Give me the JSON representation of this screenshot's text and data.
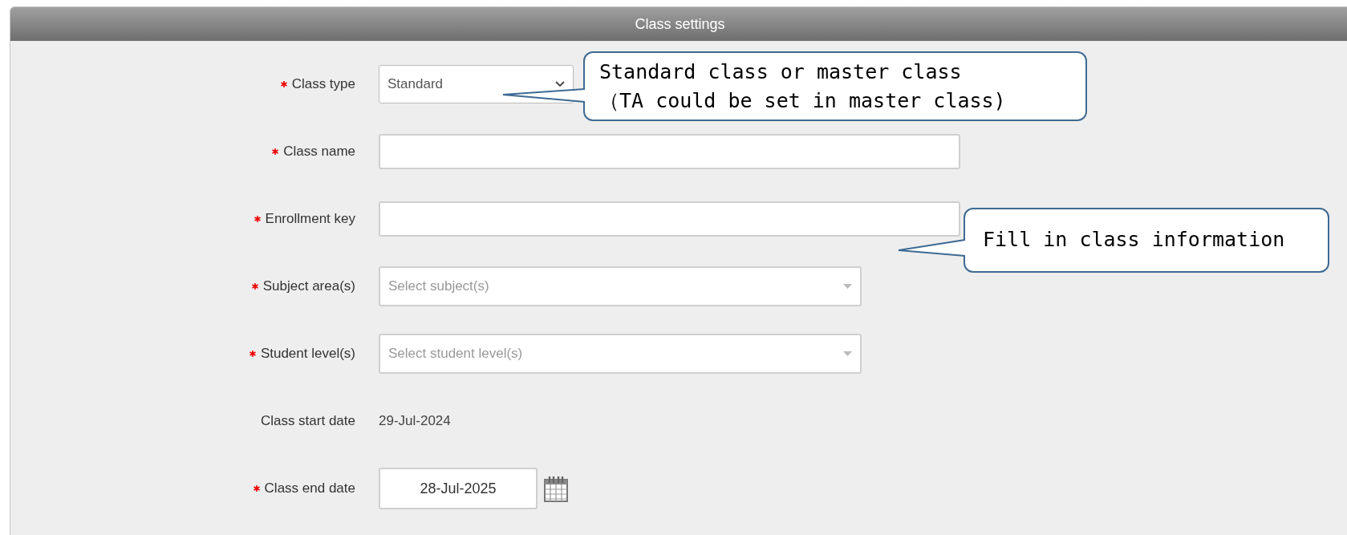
{
  "panel": {
    "title": "Class settings"
  },
  "fields": [
    {
      "kind": "select",
      "label": "Class type",
      "required": true,
      "value": "Standard"
    },
    {
      "kind": "text",
      "label": "Class name",
      "required": true
    },
    {
      "kind": "text",
      "label": "Enrollment key",
      "required": true
    },
    {
      "kind": "multiselect",
      "label": "Subject area(s)",
      "required": true,
      "placeholder": "Select subject(s)"
    },
    {
      "kind": "multiselect",
      "label": "Student level(s)",
      "required": true,
      "placeholder": "Select student level(s)"
    },
    {
      "kind": "static",
      "label": "Class start date",
      "required": false,
      "value": "29-Jul-2024"
    },
    {
      "kind": "date",
      "label": "Class end date",
      "required": true,
      "value": "28-Jul-2025"
    }
  ],
  "callouts": [
    {
      "lines": [
        "Standard class or master class",
        "（TA could be set in master class)"
      ]
    },
    {
      "lines": [
        "Fill in class information"
      ]
    }
  ]
}
